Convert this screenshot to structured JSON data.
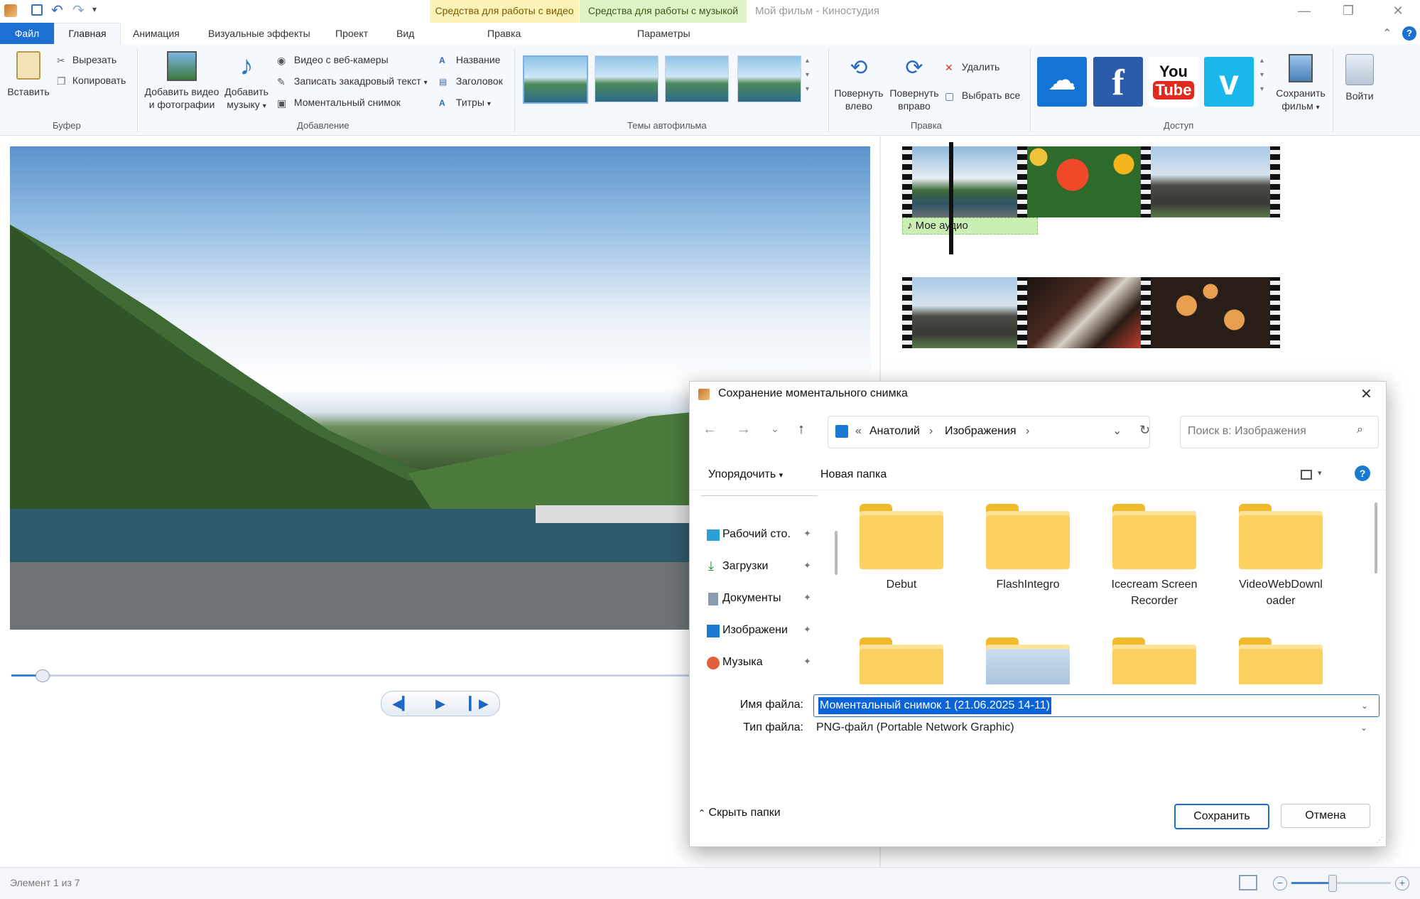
{
  "title_bar": {
    "app_title": "Мой фильм - Киностудия",
    "context_video": "Средства для работы с видео",
    "context_music": "Средства для работы с музыкой",
    "minimize": "—",
    "maximize": "❐",
    "close": "✕"
  },
  "tabs": {
    "file": "Файл",
    "home": "Главная",
    "animation": "Анимация",
    "visual_effects": "Визуальные эффекты",
    "project": "Проект",
    "view": "Вид",
    "edit_ctx": "Правка",
    "params_ctx": "Параметры"
  },
  "ribbon": {
    "clipboard": {
      "paste": "Вставить",
      "cut": "Вырезать",
      "copy": "Копировать",
      "label": "Буфер"
    },
    "add": {
      "add_video_1": "Добавить видео",
      "add_video_2": "и фотографии",
      "add_music_1": "Добавить",
      "add_music_2": "музыку",
      "webcam": "Видео с веб-камеры",
      "narration": "Записать закадровый текст",
      "snapshot": "Моментальный снимок",
      "title": "Название",
      "caption": "Заголовок",
      "credits": "Титры",
      "label": "Добавление"
    },
    "themes_label": "Темы автофильма",
    "editing": {
      "rotate_left_1": "Повернуть",
      "rotate_left_2": "влево",
      "rotate_right_1": "Повернуть",
      "rotate_right_2": "вправо",
      "delete": "Удалить",
      "select_all": "Выбрать все",
      "label": "Правка"
    },
    "share": {
      "youtube_1": "You",
      "youtube_2": "Tube",
      "save_movie_1": "Сохранить",
      "save_movie_2": "фильм",
      "sign_in": "Войти",
      "label": "Доступ"
    }
  },
  "storyboard": {
    "audio_caption": "♪ Мое аудио"
  },
  "dialog": {
    "title": "Сохранение моментального снимка",
    "breadcrumb": {
      "sep0": "«",
      "part1": "Анатолий",
      "sep1": "›",
      "part2": "Изображения",
      "sep2": "›"
    },
    "search_placeholder": "Поиск в: Изображения",
    "organize": "Упорядочить",
    "new_folder": "Новая папка",
    "nav_items": [
      "Рабочий сто.",
      "Загрузки",
      "Документы",
      "Изображени",
      "Музыка"
    ],
    "folders": [
      "Debut",
      "FlashIntegro",
      "Icecream Screen Recorder",
      "VideoWebDownloader"
    ],
    "folder_name_lines": [
      [
        "Debut"
      ],
      [
        "FlashIntegro"
      ],
      [
        "Icecream Screen",
        "Recorder"
      ],
      [
        "VideoWebDownl",
        "oader"
      ]
    ],
    "filename_label": "Имя файла:",
    "filename_value": "Моментальный снимок 1 (21.06.2025 14-11)",
    "filetype_label": "Тип файла:",
    "filetype_value": "PNG-файл (Portable Network Graphic)",
    "hide_folders": "Скрыть папки",
    "save": "Сохранить",
    "cancel": "Отмена"
  },
  "status": {
    "item_counter": "Элемент 1 из 7"
  },
  "colors": {
    "accent": "#1e6fd2",
    "ctx_video": "#fbf3b8",
    "ctx_music": "#dff3c7",
    "selection": "#0a64d8"
  },
  "playback": {
    "position_fraction": 0.035
  }
}
